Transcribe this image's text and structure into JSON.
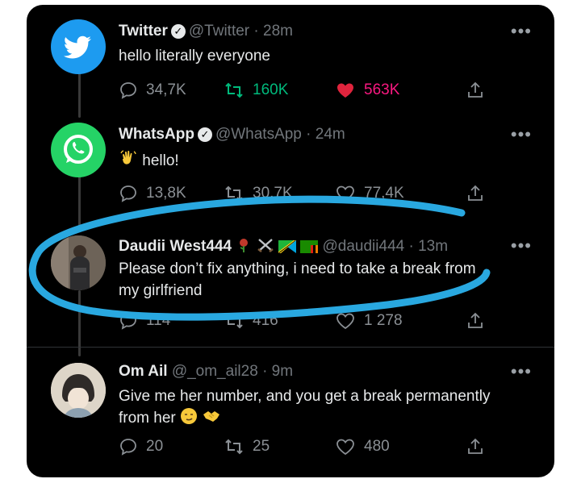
{
  "tweets": [
    {
      "name": "Twitter",
      "handle": "@Twitter",
      "time": "· 28m",
      "text": "hello literally everyone",
      "replies": "34,7K",
      "retweets": "160K",
      "likes": "563K",
      "liked": true,
      "retweeted": true,
      "avatar_icon": "twitter-bird-icon",
      "avatar_color": "#1d9bf0"
    },
    {
      "name": "WhatsApp",
      "handle": "@WhatsApp",
      "time": "· 24m",
      "text": "hello!",
      "emoji_icon": "waving-hand-icon",
      "replies": "13,8K",
      "retweets": "30,7K",
      "likes": "77,4K",
      "avatar_icon": "whatsapp-icon",
      "avatar_color": "#25d366"
    },
    {
      "name": "Daudii West444",
      "handle": "@daudii444",
      "time": "· 13m",
      "text_line1": "Please don’t fix anything, i need to take a break from",
      "text_line2": "my girlfriend",
      "name_emojis": [
        "rose-icon",
        "crossed-swords-icon",
        "tanzania-flag-icon",
        "zambia-flag-icon"
      ],
      "replies": "114",
      "retweets": "416",
      "likes": "1 278"
    },
    {
      "name": "Om Ail",
      "handle": "@_om_ail28",
      "time": "· 9m",
      "text_line1": "Give me her number, and you get a break permanently",
      "text_line2": "from her",
      "trailing_emojis": [
        "smirking-face-icon",
        "handshake-icon"
      ],
      "replies": "20",
      "retweets": "25",
      "likes": "480"
    }
  ],
  "colors": {
    "background": "#000000",
    "text": "#e7e9ea",
    "muted": "#71767b",
    "retweet_green": "#00ba7c",
    "like_red": "#f91880",
    "highlight_stroke": "#29a8e0"
  }
}
